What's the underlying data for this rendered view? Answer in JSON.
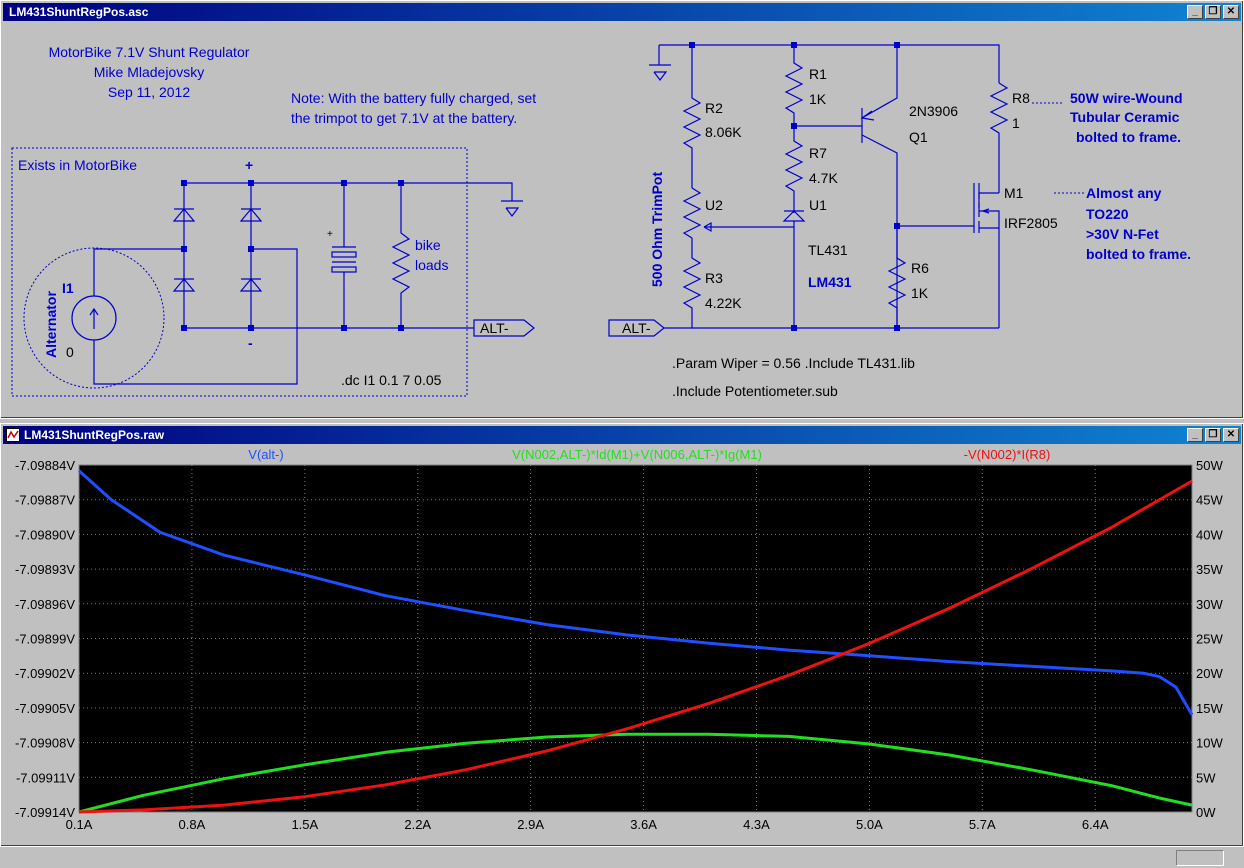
{
  "schematic_window": {
    "title": "LM431ShuntRegPos.asc",
    "buttons": {
      "minimize": "_",
      "restore": "❐",
      "close": "✕"
    }
  },
  "plot_window": {
    "title": "LM431ShuntRegPos.raw",
    "buttons": {
      "minimize": "_",
      "restore": "❐",
      "close": "✕"
    }
  },
  "schematic": {
    "header_lines": [
      "MotorBike 7.1V Shunt Regulator",
      "Mike Mladejovsky",
      "Sep 11, 2012"
    ],
    "note_lines": [
      "Note: With the battery fully charged, set",
      "the trimpot to get 7.1V at the battery."
    ],
    "box_label": "Exists in MotorBike",
    "plus_label": "+",
    "minus_label": "-",
    "cap_plus": "+",
    "alternator_label": "Alternator",
    "i1_label": "I1",
    "i1_value": "0",
    "bike_loads": [
      "bike",
      "loads"
    ],
    "dc_directive": ".dc I1 0.1 7 0.05",
    "alt_flag": "ALT-",
    "alt_flag2": "ALT-",
    "r1": {
      "name": "R1",
      "value": "1K"
    },
    "r2": {
      "name": "R2",
      "value": "8.06K"
    },
    "r3": {
      "name": "R3",
      "value": "4.22K"
    },
    "r6": {
      "name": "R6",
      "value": "1K"
    },
    "r7": {
      "name": "R7",
      "value": "4.7K"
    },
    "r8": {
      "name": "R8",
      "value": "1"
    },
    "u1": {
      "name": "U1",
      "value": "TL431",
      "alt": "LM431"
    },
    "u2": {
      "name": "U2"
    },
    "trimpot_label": "500 Ohm TrimPot",
    "q1": {
      "name": "Q1",
      "value": "2N3906"
    },
    "m1": {
      "name": "M1",
      "value": "IRF2805"
    },
    "r8_note": [
      "50W wire-Wound",
      "Tubular Ceramic",
      "bolted to frame."
    ],
    "m1_note": [
      "Almost any",
      "TO220",
      ">30V N-Fet",
      "bolted to frame."
    ],
    "param_line": ".Param Wiper = 0.56   .Include TL431.lib",
    "include_line": ".Include Potentiometer.sub"
  },
  "chart_data": {
    "type": "line",
    "series": [
      {
        "name": "V(alt-)",
        "color": "#1f4fff",
        "axis": "left",
        "x": [
          0.1,
          0.3,
          0.6,
          1.0,
          1.5,
          2.0,
          2.5,
          3.0,
          3.5,
          4.0,
          4.5,
          5.0,
          5.5,
          6.0,
          6.5,
          6.7,
          6.8,
          6.9,
          7.0
        ],
        "y": [
          -7.098845,
          -7.09887,
          -7.098898,
          -7.098918,
          -7.098935,
          -7.098953,
          -7.098966,
          -7.098978,
          -7.098987,
          -7.098994,
          -7.099,
          -7.099005,
          -7.09901,
          -7.099014,
          -7.099018,
          -7.09902,
          -7.099023,
          -7.099032,
          -7.099056
        ]
      },
      {
        "name": "V(N002,ALT-)*Id(M1)+V(N006,ALT-)*Ig(M1)",
        "color": "#22dd22",
        "axis": "right",
        "x": [
          0.1,
          0.5,
          1.0,
          1.5,
          2.0,
          2.5,
          3.0,
          3.5,
          4.0,
          4.5,
          5.0,
          5.5,
          6.0,
          6.5,
          6.8,
          7.0
        ],
        "y": [
          0,
          2.4,
          4.8,
          6.8,
          8.6,
          9.9,
          10.8,
          11.2,
          11.2,
          10.9,
          9.8,
          8.2,
          6.1,
          3.8,
          2.0,
          1.0
        ]
      },
      {
        "name": "-V(N002)*I(R8)",
        "color": "#ee1111",
        "axis": "right",
        "x": [
          0.1,
          0.5,
          1.0,
          1.5,
          2.0,
          2.5,
          3.0,
          3.5,
          4.0,
          4.5,
          5.0,
          5.5,
          6.0,
          6.5,
          7.0
        ],
        "y": [
          0,
          0.3,
          1.0,
          2.2,
          3.9,
          6.1,
          8.8,
          12.0,
          15.6,
          19.7,
          24.3,
          29.4,
          35.0,
          41.0,
          47.7
        ]
      }
    ],
    "x_ticks": [
      "0.1A",
      "0.8A",
      "1.5A",
      "2.2A",
      "2.9A",
      "3.6A",
      "4.3A",
      "5.0A",
      "5.7A",
      "6.4A"
    ],
    "x_tick_values": [
      0.1,
      0.8,
      1.5,
      2.2,
      2.9,
      3.6,
      4.3,
      5.0,
      5.7,
      6.4
    ],
    "xlim": [
      0.1,
      7.0
    ],
    "y_left_ticks": [
      "-7.09884V",
      "-7.09887V",
      "-7.09890V",
      "-7.09893V",
      "-7.09896V",
      "-7.09899V",
      "-7.09902V",
      "-7.09905V",
      "-7.09908V",
      "-7.09911V",
      "-7.09914V"
    ],
    "y_left_lim": [
      -7.09914,
      -7.09884
    ],
    "y_right_ticks": [
      "50W",
      "45W",
      "40W",
      "35W",
      "30W",
      "25W",
      "20W",
      "15W",
      "10W",
      "5W",
      "0W"
    ],
    "y_right_lim": [
      0,
      50
    ],
    "grid": true,
    "background": "#000000"
  }
}
